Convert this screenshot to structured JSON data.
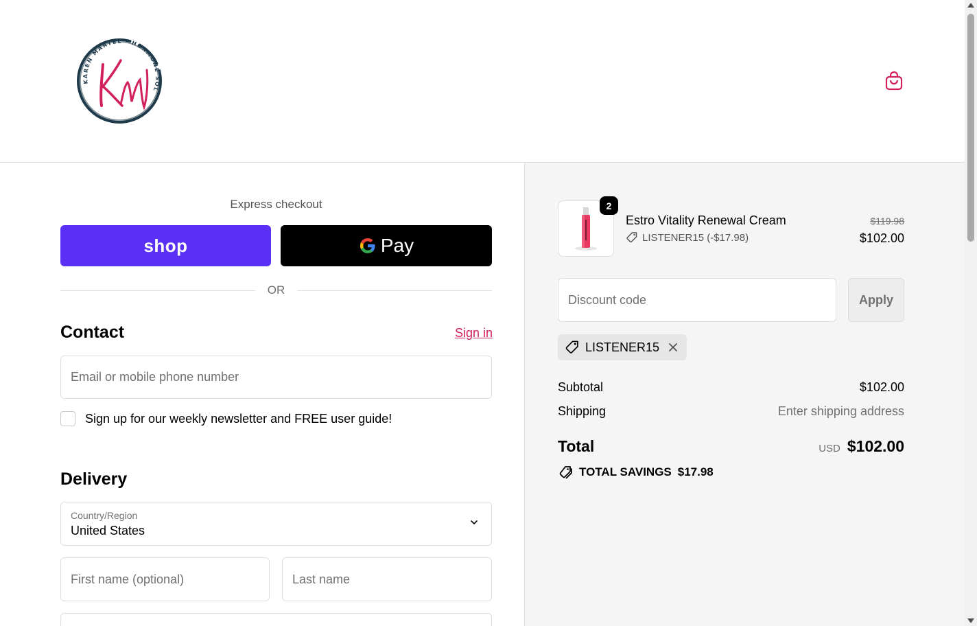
{
  "header": {
    "logo_icon": "karen-martel-hormone-solutions-logo",
    "logo_ring_text": "KAREN MARTEL · HORMONE SOLUTIONS",
    "logo_initials": "Km",
    "cart_icon": "shopping-bag-icon"
  },
  "express": {
    "title": "Express checkout",
    "shop_label": "shop",
    "gpay_label": "Pay",
    "or_label": "OR"
  },
  "contact": {
    "title": "Contact",
    "signin_label": "Sign in",
    "email_placeholder": "Email or mobile phone number",
    "newsletter_label": "Sign up for our weekly newsletter and FREE user guide!"
  },
  "delivery": {
    "title": "Delivery",
    "country_label": "Country/Region",
    "country_value": "United States",
    "first_name_placeholder": "First name (optional)",
    "last_name_placeholder": "Last name"
  },
  "order": {
    "quantity": "2",
    "product_name": "Estro Vitality Renewal Cream",
    "product_discount": "LISTENER15 (-$17.98)",
    "price_original": "$119.98",
    "price_final": "$102.00"
  },
  "discount": {
    "placeholder": "Discount code",
    "apply_label": "Apply",
    "applied_code": "LISTENER15"
  },
  "summary": {
    "subtotal_label": "Subtotal",
    "subtotal_value": "$102.00",
    "shipping_label": "Shipping",
    "shipping_value": "Enter shipping address",
    "total_label": "Total",
    "currency": "USD",
    "total_value": "$102.00",
    "savings_label": "TOTAL SAVINGS",
    "savings_value": "$17.98"
  },
  "colors": {
    "brand_pink": "#d21f5d",
    "shop_purple": "#5a31f4",
    "logo_navy": "#1f3a4a"
  }
}
